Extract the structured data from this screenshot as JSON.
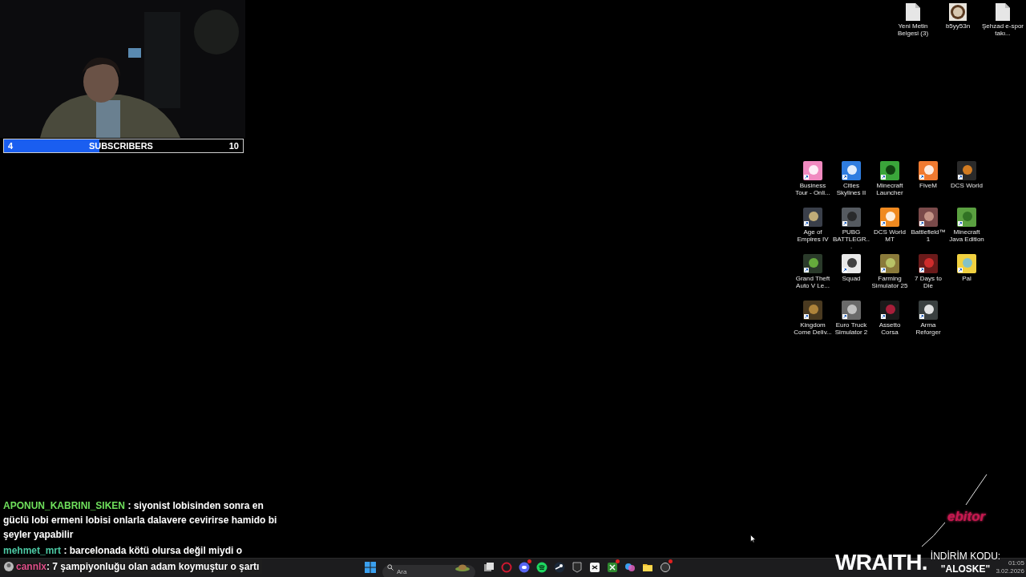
{
  "subscriber_goal": {
    "current": "4",
    "label": "SUBSCRIBERS",
    "goal": "10",
    "level": 0.4
  },
  "desktop_files": [
    {
      "label": "Yeni Metin Belgesi (3)",
      "kind": "document"
    },
    {
      "label": "b5yy53n"
    },
    {
      "label": "Şehzad e-spor takı...",
      "kind": "document"
    }
  ],
  "desktop_shortcuts": [
    {
      "label": "Business Tour - Onli..."
    },
    {
      "label": "Cities Skylines II"
    },
    {
      "label": "Minecraft Launcher"
    },
    {
      "label": "FiveM"
    },
    {
      "label": "DCS World"
    },
    {
      "label": "Age of Empires IV"
    },
    {
      "label": "PUBG BATTLEGR..."
    },
    {
      "label": "DCS World MT"
    },
    {
      "label": "Battlefield™ 1"
    },
    {
      "label": "Minecraft Java Edition"
    },
    {
      "label": "Grand Theft Auto V Le..."
    },
    {
      "label": "Squad"
    },
    {
      "label": "Farming Simulator 25"
    },
    {
      "label": "7 Days to Die"
    },
    {
      "label": "Pal"
    },
    {
      "label": "Kingdom Come Deliv..."
    },
    {
      "label": "Euro Truck Simulator 2"
    },
    {
      "label": "Assetto Corsa"
    },
    {
      "label": "Arma Reforger"
    }
  ],
  "chat": [
    {
      "user": "APONUN_KABRINI_SIKEN",
      "color": "#6fe05c",
      "text": ": siyonist lobisinden sonra en güclü lobi ermeni lobisi onlarla dalavere cevirirse hamido bi şeyler yapabilir",
      "kind": "plain"
    },
    {
      "user": "mehmet_mrt",
      "color": "#4cc9a4",
      "text": ": barcelonada kötü olursa değil miydi o",
      "kind": "plain"
    },
    {
      "user": "cannlx",
      "color": "#e0508a",
      "text": ": 7 şampiyonluğu olan adam koymuştur o şartı",
      "kind": "avatar"
    }
  ],
  "taskbar": {
    "search_placeholder": "Ara",
    "apps": [
      {
        "kind": "taskview",
        "badge": false
      },
      {
        "kind": "opera",
        "badge": false
      },
      {
        "kind": "discord",
        "badge": true
      },
      {
        "kind": "spotify",
        "badge": false
      },
      {
        "kind": "steam",
        "badge": false
      },
      {
        "kind": "epic",
        "badge": false
      },
      {
        "kind": "capcut",
        "badge": false
      },
      {
        "kind": "xbox",
        "badge": true
      },
      {
        "kind": "copilot",
        "badge": false
      },
      {
        "kind": "folder",
        "badge": false
      },
      {
        "kind": "app",
        "badge": true
      }
    ],
    "time": "01:05",
    "date": "3.02.2026"
  },
  "neon_logo": "ebitor",
  "sponsor": {
    "brand": "WRAITH.",
    "code_label": "İNDİRİM KODU:",
    "code": "\"ALOSKE\""
  }
}
